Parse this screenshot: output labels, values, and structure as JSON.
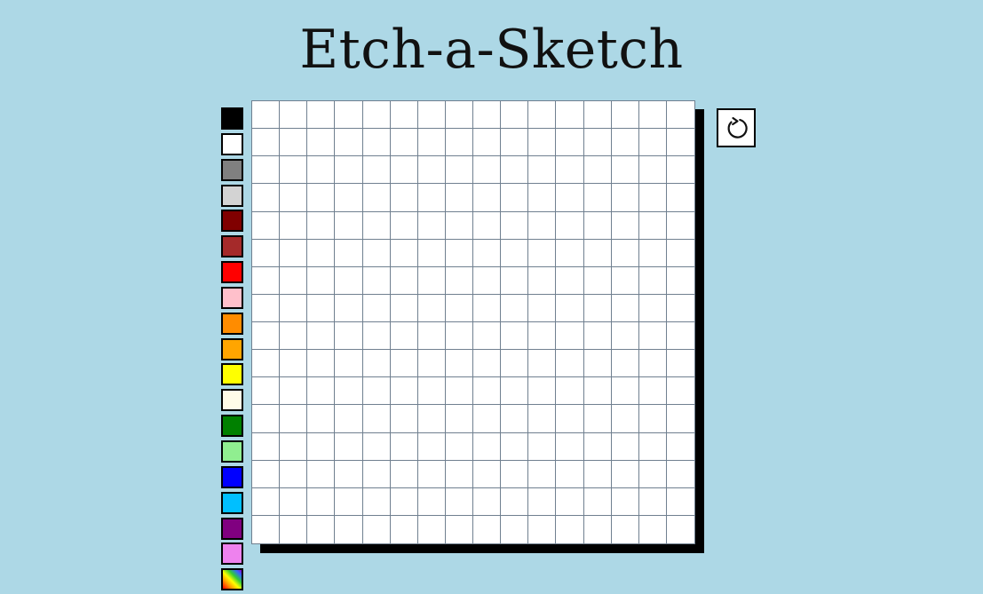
{
  "title": "Etch-a-Sketch",
  "palette": [
    {
      "name": "black",
      "color": "#000000"
    },
    {
      "name": "white",
      "color": "#ffffff"
    },
    {
      "name": "gray",
      "color": "#808080"
    },
    {
      "name": "light-gray",
      "color": "#d3d3d3"
    },
    {
      "name": "maroon",
      "color": "#800000"
    },
    {
      "name": "brown",
      "color": "#a52a2a"
    },
    {
      "name": "red",
      "color": "#ff0000"
    },
    {
      "name": "pink",
      "color": "#ffc0cb"
    },
    {
      "name": "dark-orange",
      "color": "#ff8c00"
    },
    {
      "name": "orange",
      "color": "#ffa500"
    },
    {
      "name": "yellow",
      "color": "#ffff00"
    },
    {
      "name": "ivory",
      "color": "#fffce8"
    },
    {
      "name": "green",
      "color": "#008000"
    },
    {
      "name": "light-green",
      "color": "#90ee90"
    },
    {
      "name": "blue",
      "color": "#0000ff"
    },
    {
      "name": "deep-sky-blue",
      "color": "#00bfff"
    },
    {
      "name": "purple",
      "color": "#800080"
    },
    {
      "name": "violet",
      "color": "#ee82ee"
    },
    {
      "name": "rainbow",
      "color": "rainbow"
    }
  ],
  "grid": {
    "columns": 16,
    "rows": 16,
    "cell_color": "#ffffff",
    "line_color": "#708090"
  },
  "reset_button": {
    "icon": "reset-icon"
  },
  "colors": {
    "background": "#add8e6",
    "shadow": "#000000"
  }
}
